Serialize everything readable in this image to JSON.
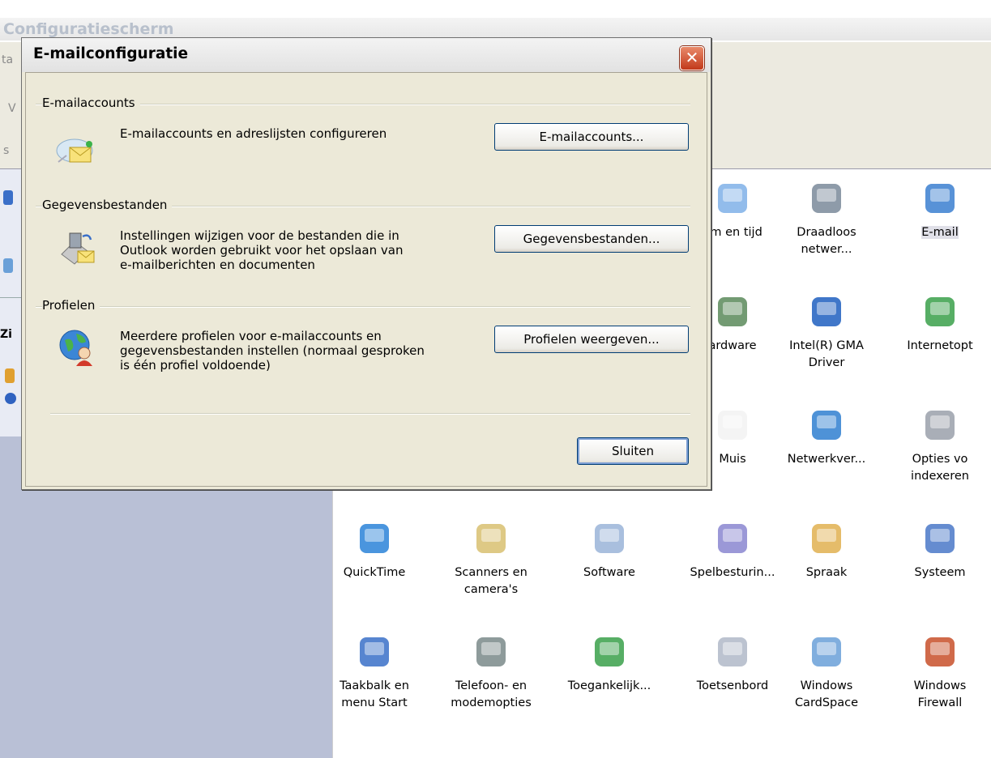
{
  "background_window": {
    "title": "Configuratiescherm",
    "menu_fragment": "ta",
    "toolbar_fragment": "V",
    "address_fragment": "s",
    "left_panel_fragment": "Zi",
    "icons": [
      {
        "label": "um en tijd",
        "icon": "clock-icon"
      },
      {
        "label": "Draadloos\nnetwer...",
        "icon": "wireless-usb-icon"
      },
      {
        "label": "E-mail",
        "icon": "email-icon",
        "selected": true
      },
      {
        "label": "ardware",
        "icon": "hardware-icon"
      },
      {
        "label": "Intel(R) GMA\nDriver",
        "icon": "intel-gma-icon"
      },
      {
        "label": "Internetopt",
        "icon": "internet-options-icon"
      },
      {
        "label": "Muis",
        "icon": "mouse-icon"
      },
      {
        "label": "Netwerkver...",
        "icon": "network-globe-icon"
      },
      {
        "label": "Opties vo\nindexeren",
        "icon": "search-index-icon"
      },
      {
        "label": "QuickTime",
        "icon": "quicktime-icon"
      },
      {
        "label": "Scanners en\ncamera's",
        "icon": "scanner-camera-icon"
      },
      {
        "label": "Software",
        "icon": "software-cd-icon"
      },
      {
        "label": "Spelbesturin...",
        "icon": "gamepad-icon"
      },
      {
        "label": "Spraak",
        "icon": "speech-icon"
      },
      {
        "label": "Systeem",
        "icon": "system-monitor-icon"
      },
      {
        "label": "Taakbalk en\nmenu Start",
        "icon": "taskbar-icon"
      },
      {
        "label": "Telefoon- en\nmodemopties",
        "icon": "phone-modem-icon"
      },
      {
        "label": "Toegankelijk...",
        "icon": "accessibility-icon"
      },
      {
        "label": "Toetsenbord",
        "icon": "keyboard-icon"
      },
      {
        "label": "Windows\nCardSpace",
        "icon": "cardspace-icon"
      },
      {
        "label": "Windows\nFirewall",
        "icon": "firewall-icon"
      }
    ]
  },
  "dialog": {
    "title": "E-mailconfiguratie",
    "close_label": "✕",
    "groups": [
      {
        "title": "E-mailaccounts",
        "icon": "email-accounts-icon",
        "description": "E-mailaccounts en adreslijsten configureren",
        "button": "E-mailaccounts..."
      },
      {
        "title": "Gegevensbestanden",
        "icon": "data-files-icon",
        "description": "Instellingen wijzigen voor de bestanden die in\nOutlook worden gebruikt voor het opslaan van\ne-mailberichten en documenten",
        "button": "Gegevensbestanden..."
      },
      {
        "title": "Profielen",
        "icon": "profiles-icon",
        "description": "Meerdere profielen voor e-mailaccounts en\ngegevensbestanden instellen (normaal gesproken\nis één profiel voldoende)",
        "button": "Profielen weergeven..."
      }
    ],
    "close_button": "Sluiten"
  }
}
